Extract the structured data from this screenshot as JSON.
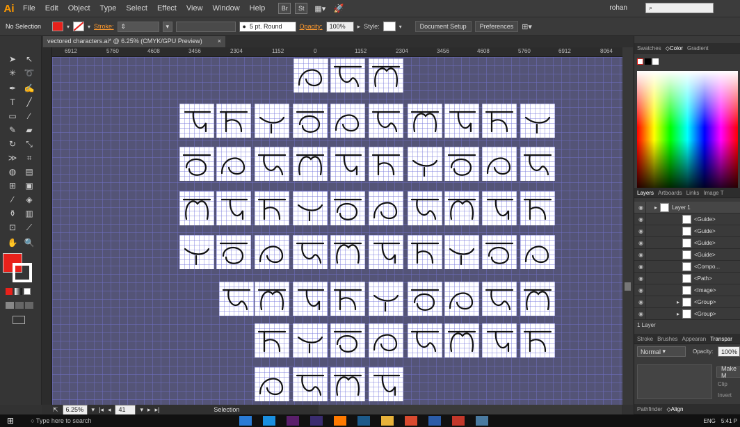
{
  "app": {
    "logo": "Ai",
    "user": "rohan",
    "bridge_btn": "Br",
    "stock_btn": "St"
  },
  "menu": [
    "File",
    "Edit",
    "Object",
    "Type",
    "Select",
    "Effect",
    "View",
    "Window",
    "Help"
  ],
  "control": {
    "selection": "No Selection",
    "stroke_label": "Stroke:",
    "stroke_profile": "5 pt. Round",
    "opacity_label": "Opacity:",
    "opacity_value": "100%",
    "style_label": "Style:",
    "doc_setup": "Document Setup",
    "preferences": "Preferences"
  },
  "document": {
    "tab_title": "vectored characters.ai* @ 6.25% (CMYK/GPU Preview)",
    "ruler_ticks": [
      "6912",
      "5760",
      "4608",
      "3456",
      "2304",
      "1152",
      "0",
      "1152",
      "2304",
      "3456",
      "4608",
      "5760",
      "6912",
      "8064"
    ],
    "zoom": "6.25%",
    "artboard": "41",
    "status": "Selection"
  },
  "panels": {
    "top_tabs": [
      "Swatches",
      "Color",
      "Gradient"
    ],
    "layers_tabs": [
      "Layers",
      "Artboards",
      "Links",
      "Image T"
    ],
    "layers": [
      "Layer 1",
      "<Guide>",
      "<Guide>",
      "<Guide>",
      "<Guide>",
      "<Compo...",
      "<Path>",
      "<Image>",
      "<Group>",
      "<Group>"
    ],
    "layer_count": "1 Layer",
    "bottom_tabs": [
      "Stroke",
      "Brushes",
      "Appearan",
      "Transpar"
    ],
    "blend_mode": "Normal",
    "opacity_label": "Opacity:",
    "opacity_value": "100%",
    "make_mask": "Make M",
    "clip": "Clip",
    "invert": "Invert",
    "footer_tabs": [
      "Pathfinder",
      "Align"
    ]
  },
  "taskbar": {
    "search": "Type here to search",
    "lang": "ENG",
    "time": "5:41 P"
  },
  "colors": {
    "fill": "#e8211b",
    "accent": "#ff9a2e",
    "canvas": "#545477"
  }
}
